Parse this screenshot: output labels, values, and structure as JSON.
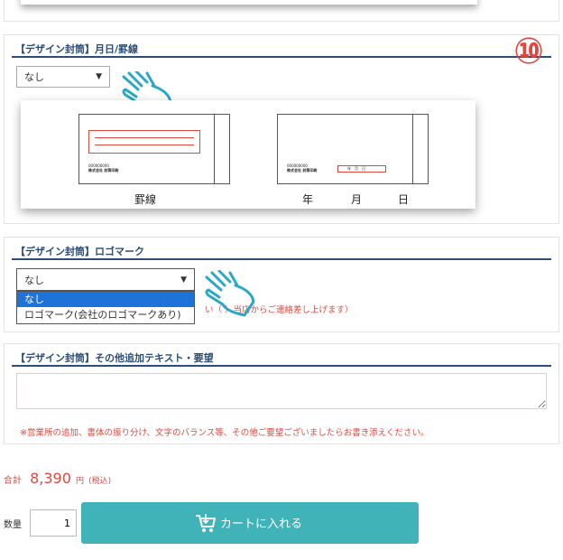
{
  "step_marker": "⑩",
  "sections": {
    "month_day": {
      "title": "【デザイン封筒】月日/罫線",
      "select_value": "なし",
      "envelope_left": {
        "text_line1": "000000000",
        "text_line2": "株式会社 封筒印刷",
        "caption": "罫線"
      },
      "envelope_right": {
        "text_line1": "000000000",
        "text_line2": "株式会社 封筒印刷",
        "date_box": "年　月　日",
        "caption_year": "年",
        "caption_month": "月",
        "caption_day": "日"
      }
    },
    "logo_mark": {
      "title": "【デザイン封筒】ロゴマーク",
      "select_value": "なし",
      "options": [
        "なし",
        "ロゴマーク(会社のロゴマークあり)"
      ],
      "note": "い（ ）当店からご連絡差し上げます）"
    },
    "other_text": {
      "title": "【デザイン封筒】その他追加テキスト・要望",
      "textarea_value": "",
      "note": "※営業所の追加、書体の振り分け、文字のバランス等、その他ご要望ございましたらお書き添えください。"
    }
  },
  "total": {
    "label": "合計",
    "amount": "8,390",
    "unit": "円",
    "tax": "(税込)"
  },
  "quantity": {
    "label": "数量",
    "value": "1"
  },
  "cart_button": {
    "label": "カートに入れる"
  },
  "colors": {
    "section_title": "#2b4d78",
    "accent_red": "#e2473f",
    "cart_button": "#3fb3b7",
    "selected_option": "#1e73d8",
    "pointer": "#2aa7c9"
  },
  "icons": [
    "hand-pointer-icon",
    "cart-icon",
    "dropdown-arrow-icon"
  ]
}
